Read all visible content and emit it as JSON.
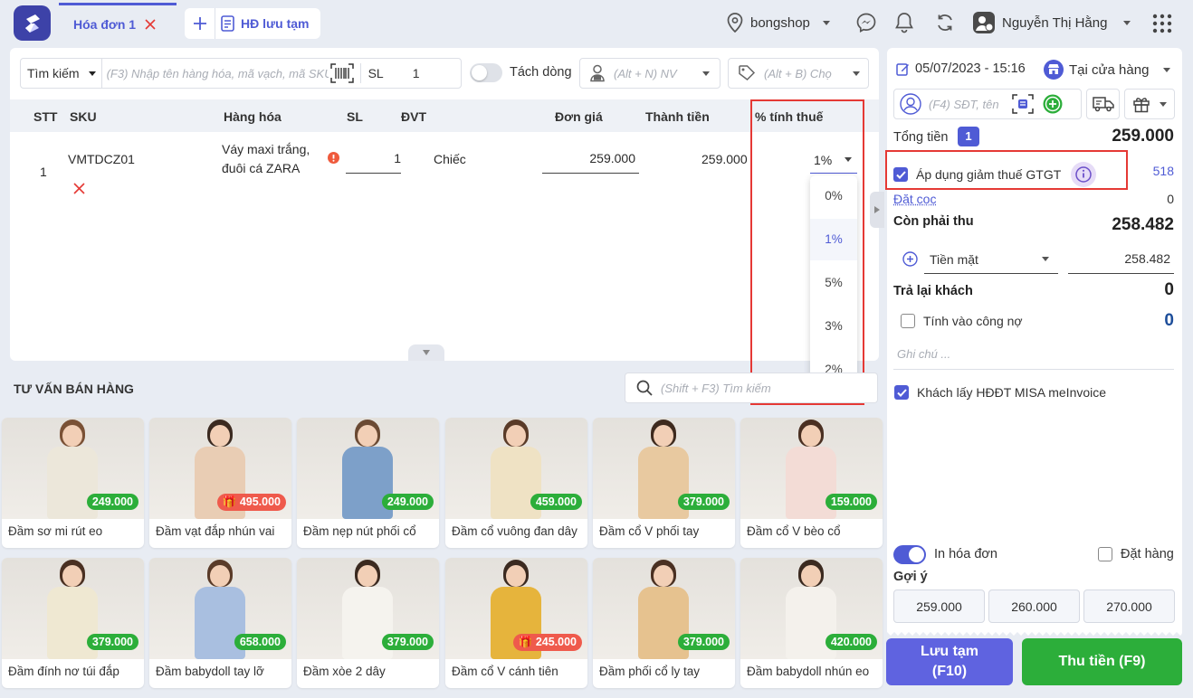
{
  "header": {
    "tab_active": "Hóa đơn 1",
    "tab_draft": "HĐ lưu tạm",
    "shop": "bongshop",
    "user": "Nguyễn Thị Hằng"
  },
  "search": {
    "mode": "Tìm kiếm",
    "placeholder": "(F3) Nhập tên hàng hóa, mã vạch, mã SKU",
    "qty_label": "SL",
    "qty_value": "1",
    "split_label": "Tách dòng",
    "staff_placeholder": "(Alt + N) NV",
    "price_placeholder": "(Alt + B) Chọ"
  },
  "table": {
    "headers": [
      "STT",
      "SKU",
      "Hàng hóa",
      "SL",
      "ĐVT",
      "Đơn giá",
      "Thành tiền",
      "% tính thuế"
    ],
    "rows": [
      {
        "stt": "1",
        "sku": "VMTDCZ01",
        "name_line1": "Váy maxi trắng,",
        "name_line2": "đuôi cá ZARA",
        "qty": "1",
        "unit": "Chiếc",
        "price": "259.000",
        "total": "259.000",
        "tax": "1%"
      }
    ]
  },
  "tax_dropdown": {
    "options": [
      "0%",
      "1%",
      "5%",
      "3%",
      "2%"
    ],
    "selected": "1%"
  },
  "advice": {
    "title": "TƯ VẤN BÁN HÀNG",
    "search_placeholder": "(Shift + F3) Tìm kiếm",
    "products": [
      {
        "name": "Đầm sơ mi rút eo",
        "price": "249.000",
        "promo": false,
        "dress": "#ece7da",
        "hair": "#7a5135"
      },
      {
        "name": "Đầm vạt đắp nhún vai",
        "price": "495.000",
        "promo": true,
        "dress": "#e9cdb4",
        "hair": "#3b2a20"
      },
      {
        "name": "Đầm nẹp nút phối cổ",
        "price": "249.000",
        "promo": false,
        "dress": "#7da0c9",
        "hair": "#6b4a33"
      },
      {
        "name": "Đầm cổ vuông đan dây",
        "price": "459.000",
        "promo": false,
        "dress": "#efe2c4",
        "hair": "#5a3b28"
      },
      {
        "name": "Đầm cổ V phối tay",
        "price": "379.000",
        "promo": false,
        "dress": "#e8c9a0",
        "hair": "#3e2a1e"
      },
      {
        "name": "Đầm cổ V bèo cổ",
        "price": "159.000",
        "promo": false,
        "dress": "#f3dcd6",
        "hair": "#4a3022"
      },
      {
        "name": "Đầm đính nơ túi đắp",
        "price": "379.000",
        "promo": false,
        "dress": "#efe8d2",
        "hair": "#4a3022"
      },
      {
        "name": "Đầm babydoll tay lỡ",
        "price": "658.000",
        "promo": false,
        "dress": "#a9bfe0",
        "hair": "#5a3b28"
      },
      {
        "name": "Đầm xòe 2 dây",
        "price": "379.000",
        "promo": false,
        "dress": "#f5f3ee",
        "hair": "#3b2a20"
      },
      {
        "name": "Đầm cổ V cánh tiên",
        "price": "245.000",
        "promo": true,
        "dress": "#e6b43c",
        "hair": "#3b2a20"
      },
      {
        "name": "Đầm phối cổ ly tay",
        "price": "379.000",
        "promo": false,
        "dress": "#e6c28f",
        "hair": "#4a3022"
      },
      {
        "name": "Đầm babydoll nhún eo",
        "price": "420.000",
        "promo": false,
        "dress": "#f4f1ec",
        "hair": "#3b2a20"
      }
    ]
  },
  "right": {
    "datetime": "05/07/2023 - 15:16",
    "channel": "Tại cửa hàng",
    "customer_placeholder": "(F4) SĐT, tên",
    "total_label": "Tổng tiền",
    "total_count": "1",
    "total_value": "259.000",
    "vat_label": "Áp dụng giảm thuế GTGT",
    "vat_value": "518",
    "deposit_label": "Đặt cọc",
    "deposit_value": "0",
    "due_label": "Còn phải thu",
    "due_value": "258.482",
    "pay_method": "Tiền mặt",
    "pay_value": "258.482",
    "change_label": "Trả lại khách",
    "change_value": "0",
    "debt_label": "Tính vào công nợ",
    "debt_value": "0",
    "note_placeholder": "Ghi chú ...",
    "einvoice_label": "Khách lấy HĐĐT MISA meInvoice",
    "print_label": "In hóa đơn",
    "order_label": "Đặt hàng",
    "suggest_label": "Gợi ý",
    "suggestions": [
      "259.000",
      "260.000",
      "270.000"
    ],
    "save_line1": "Lưu tạm",
    "save_line2": "(F10)",
    "pay_button": "Thu tiền (F9)"
  },
  "colors": {
    "accent": "#4f5bd5",
    "green": "#2cae3a",
    "red": "#e53935",
    "navy": "#1d4e9a"
  }
}
